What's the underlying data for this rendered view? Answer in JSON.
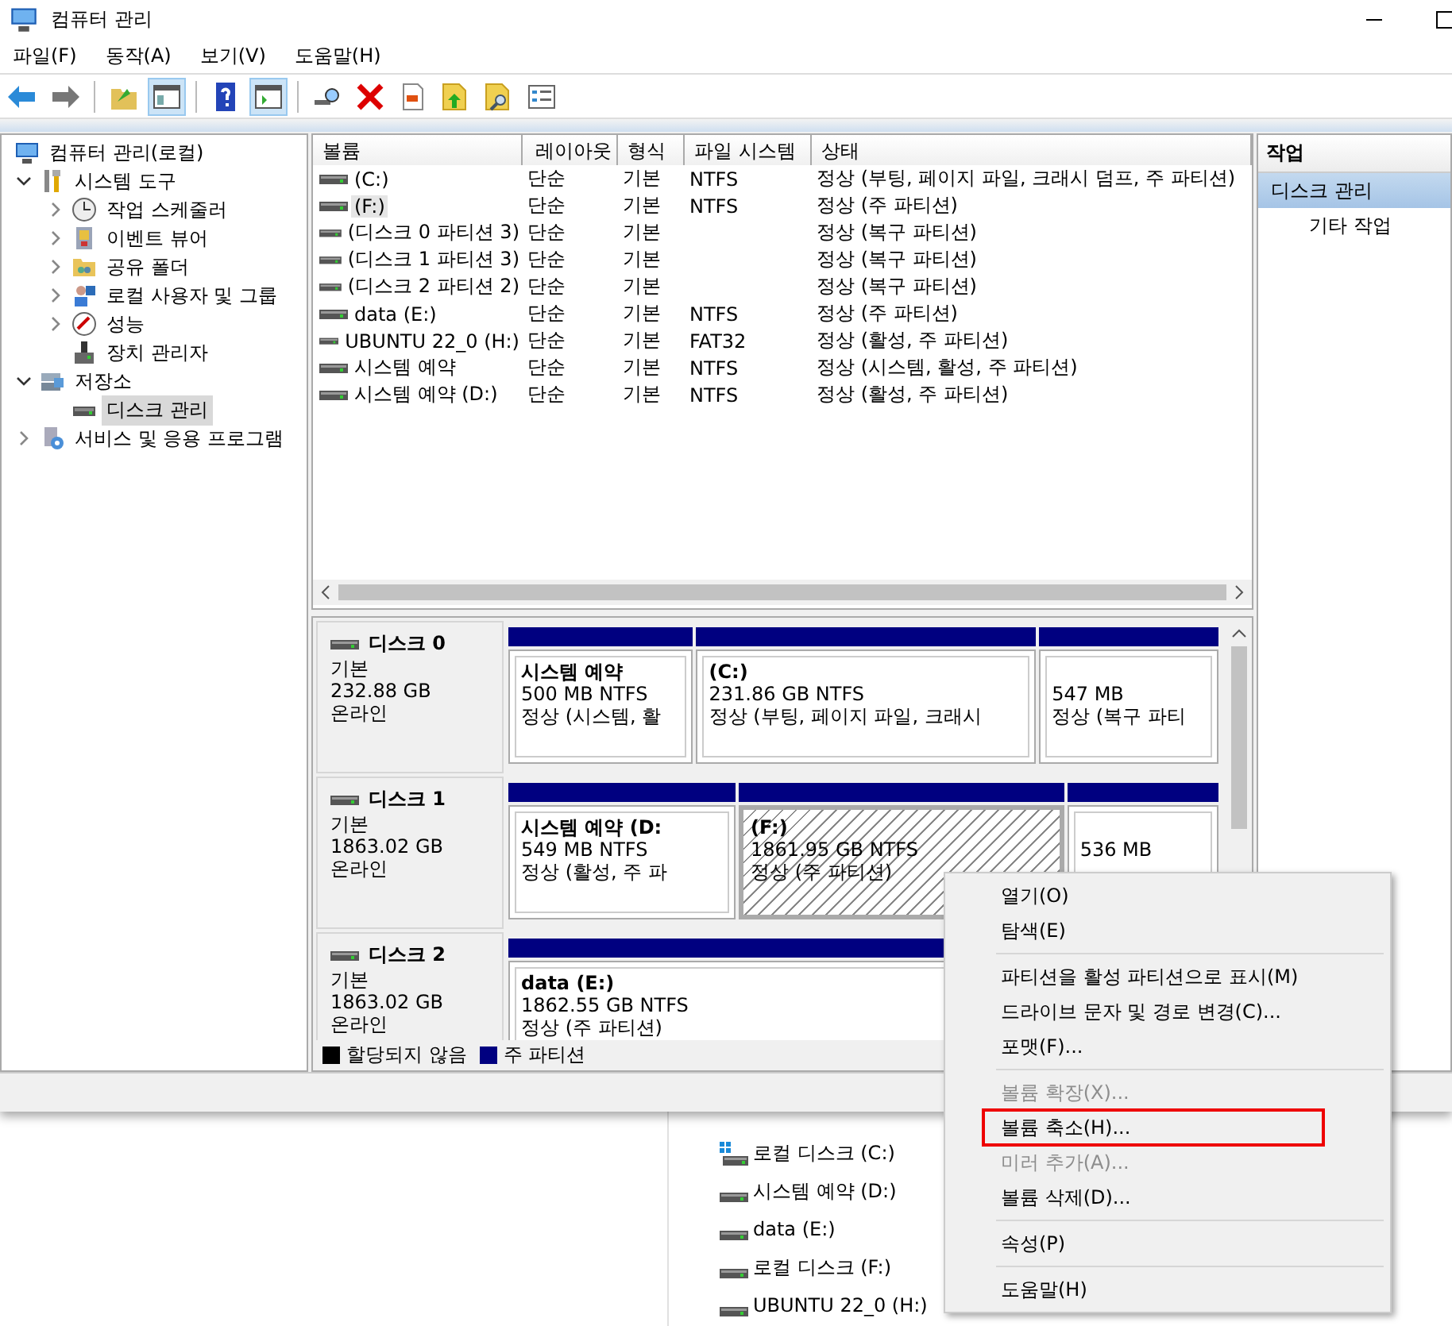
{
  "window": {
    "title": "컴퓨터 관리"
  },
  "menu": [
    "파일(F)",
    "동작(A)",
    "보기(V)",
    "도움말(H)"
  ],
  "toolbar": [
    {
      "pressed": false
    },
    {
      "pressed": false
    },
    {
      "pressed": false
    },
    {
      "pressed": true
    },
    {
      "pressed": false
    },
    {
      "pressed": true
    },
    {
      "pressed": false
    },
    {
      "pressed": false
    },
    {
      "pressed": false
    },
    {
      "pressed": false
    },
    {
      "pressed": false
    },
    {
      "pressed": false
    }
  ],
  "tree": [
    {
      "label": "컴퓨터 관리(로컬)",
      "kind": "root",
      "selected": false,
      "children": [
        {
          "label": "시스템 도구",
          "kind": "branch",
          "expanded": true,
          "selected": false,
          "children": [
            {
              "label": "작업 스케줄러",
              "kind": "branch",
              "expanded": false,
              "selected": false
            },
            {
              "label": "이벤트 뷰어",
              "kind": "branch",
              "expanded": false,
              "selected": false
            },
            {
              "label": "공유 폴더",
              "kind": "branch",
              "expanded": false,
              "selected": false
            },
            {
              "label": "로컬 사용자 및 그룹",
              "kind": "branch",
              "expanded": false,
              "selected": false
            },
            {
              "label": "성능",
              "kind": "branch",
              "expanded": false,
              "selected": false
            },
            {
              "label": "장치 관리자",
              "kind": "leaf",
              "selected": false
            }
          ]
        },
        {
          "label": "저장소",
          "kind": "branch",
          "expanded": true,
          "selected": false,
          "children": [
            {
              "label": "디스크 관리",
              "kind": "leaf",
              "selected": true
            }
          ]
        },
        {
          "label": "서비스 및 응용 프로그램",
          "kind": "branch",
          "expanded": false,
          "selected": false
        }
      ]
    }
  ],
  "volumes": {
    "columns": [
      "볼륨",
      "레이아웃",
      "형식",
      "파일 시스템",
      "상태"
    ],
    "rows": [
      {
        "cells": [
          "(C:)",
          "단순",
          "기본",
          "NTFS",
          "정상 (부팅, 페이지 파일, 크래시 덤프, 주 파티션)"
        ],
        "selected": false
      },
      {
        "cells": [
          "(F:)",
          "단순",
          "기본",
          "NTFS",
          "정상 (주 파티션)"
        ],
        "selected": true
      },
      {
        "cells": [
          "(디스크 0 파티션 3)",
          "단순",
          "기본",
          "",
          "정상 (복구 파티션)"
        ],
        "selected": false
      },
      {
        "cells": [
          "(디스크 1 파티션 3)",
          "단순",
          "기본",
          "",
          "정상 (복구 파티션)"
        ],
        "selected": false
      },
      {
        "cells": [
          "(디스크 2 파티션 2)",
          "단순",
          "기본",
          "",
          "정상 (복구 파티션)"
        ],
        "selected": false
      },
      {
        "cells": [
          "data (E:)",
          "단순",
          "기본",
          "NTFS",
          "정상 (주 파티션)"
        ],
        "selected": false
      },
      {
        "cells": [
          "UBUNTU 22_0 (H:)",
          "단순",
          "기본",
          "FAT32",
          "정상 (활성, 주 파티션)"
        ],
        "selected": false
      },
      {
        "cells": [
          "시스템 예약",
          "단순",
          "기본",
          "NTFS",
          "정상 (시스템, 활성, 주 파티션)"
        ],
        "selected": false
      },
      {
        "cells": [
          "시스템 예약 (D:)",
          "단순",
          "기본",
          "NTFS",
          "정상 (활성, 주 파티션)"
        ],
        "selected": false
      }
    ]
  },
  "disks": [
    {
      "name": "디스크 0",
      "type": "기본",
      "size": "232.88 GB",
      "status": "온라인",
      "partitions": [
        {
          "label": "시스템 예약",
          "size": "500 MB NTFS",
          "status": "정상 (시스템, 활",
          "selected": false
        },
        {
          "label": "(C:)",
          "size": "231.86 GB NTFS",
          "status": "정상 (부팅, 페이지 파일, 크래시",
          "selected": false
        },
        {
          "size": "547 MB",
          "status": "정상 (복구 파티",
          "selected": false
        }
      ]
    },
    {
      "name": "디스크 1",
      "type": "기본",
      "size": "1863.02 GB",
      "status": "온라인",
      "partitions": [
        {
          "label": "시스템 예약  (D:",
          "size": "549 MB NTFS",
          "status": "정상 (활성, 주 파",
          "selected": false
        },
        {
          "label": "(F:)",
          "size": "1861.95 GB NTFS",
          "status": "정상 (주 파티션)",
          "selected": true
        },
        {
          "size": "536 MB",
          "selected": false
        }
      ]
    },
    {
      "name": "디스크 2",
      "type": "기본",
      "size": "1863.02 GB",
      "status": "온라인",
      "partitions": [
        {
          "label": "data  (E:)",
          "size": "1862.55 GB NTFS",
          "status": "정상 (주 파티션)",
          "selected": false
        }
      ]
    }
  ],
  "legend": [
    {
      "label": "할당되지 않음",
      "color": "#000000"
    },
    {
      "label": "주 파티션",
      "color": "#000080"
    }
  ],
  "actions": {
    "header": "작업",
    "items": [
      {
        "label": "디스크 관리",
        "selected": true
      },
      {
        "label": "기타 작업",
        "selected": false
      }
    ]
  },
  "context_menu": [
    {
      "kind": "item",
      "label": "열기(O)",
      "disabled": false,
      "selected": false
    },
    {
      "kind": "item",
      "label": "탐색(E)",
      "disabled": false,
      "selected": false
    },
    {
      "kind": "separator"
    },
    {
      "kind": "item",
      "label": "파티션을 활성 파티션으로 표시(M)",
      "disabled": false,
      "selected": false
    },
    {
      "kind": "item",
      "label": "드라이브 문자 및 경로 변경(C)...",
      "disabled": false,
      "selected": false
    },
    {
      "kind": "item",
      "label": "포맷(F)...",
      "disabled": false,
      "selected": false
    },
    {
      "kind": "separator"
    },
    {
      "kind": "item",
      "label": "볼륨 확장(X)...",
      "disabled": true,
      "selected": false
    },
    {
      "kind": "item",
      "label": "볼륨 축소(H)...",
      "disabled": false,
      "selected": true
    },
    {
      "kind": "item",
      "label": "미러 추가(A)...",
      "disabled": true,
      "selected": false
    },
    {
      "kind": "item",
      "label": "볼륨 삭제(D)...",
      "disabled": false,
      "selected": false
    },
    {
      "kind": "separator"
    },
    {
      "kind": "item",
      "label": "속성(P)",
      "disabled": false,
      "selected": false
    },
    {
      "kind": "separator"
    },
    {
      "kind": "item",
      "label": "도움말(H)",
      "disabled": false,
      "selected": false
    }
  ],
  "explorer_items": [
    "로컬 디스크 (C:)",
    "시스템 예약 (D:)",
    "data (E:)",
    "로컬 디스크 (F:)",
    "UBUNTU 22_0 (H:)"
  ]
}
